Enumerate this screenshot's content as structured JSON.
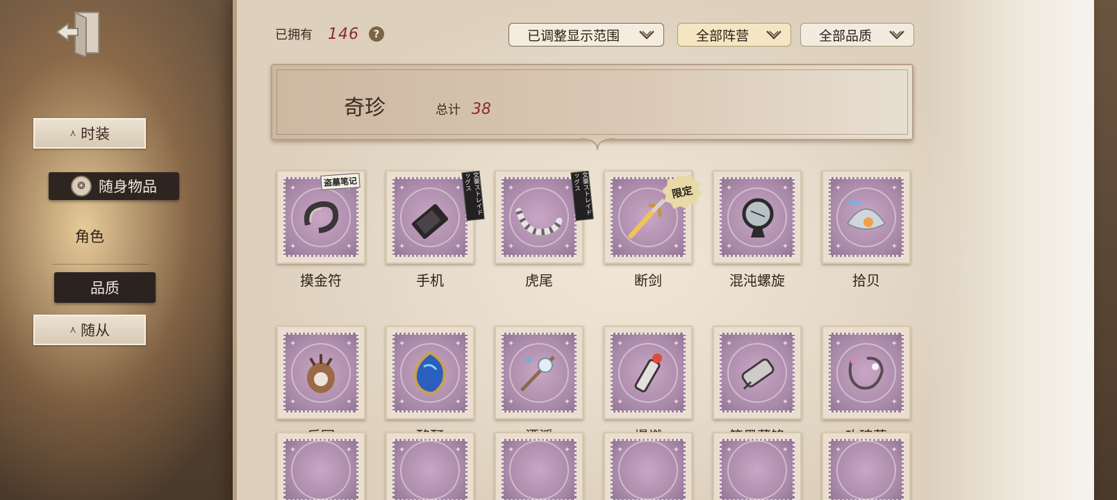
{
  "sidebar": {
    "exit_icon": "exit-door-icon",
    "items": [
      {
        "label": "时装",
        "style": "tab"
      },
      {
        "label": "随身物品",
        "style": "active"
      },
      {
        "label": "角色",
        "style": "plain"
      },
      {
        "label": "品质",
        "style": "dark"
      },
      {
        "label": "随从",
        "style": "tab"
      }
    ]
  },
  "header": {
    "owned_label": "已拥有",
    "owned_count": "146",
    "help_label": "?",
    "filters": [
      {
        "label": "已调整显示范围"
      },
      {
        "label": "全部阵营"
      },
      {
        "label": "全部品质"
      }
    ]
  },
  "banner": {
    "title": "奇珍",
    "total_label": "总计",
    "total_value": "38"
  },
  "items": [
    {
      "name": "摸金符",
      "badge": "盗墓笔记"
    },
    {
      "name": "手机",
      "badge": "文豪ストレイドッグス"
    },
    {
      "name": "虎尾",
      "badge": "文豪ストレイドッグス"
    },
    {
      "name": "断剑",
      "badge": "限定"
    },
    {
      "name": "混沌螺旋",
      "badge": ""
    },
    {
      "name": "拾贝",
      "badge": ""
    },
    {
      "name": "乐园",
      "badge": ""
    },
    {
      "name": "酩酊",
      "badge": ""
    },
    {
      "name": "漂浮",
      "badge": ""
    },
    {
      "name": "爆燃",
      "badge": ""
    },
    {
      "name": "笔墨藏锋",
      "badge": ""
    },
    {
      "name": "玫瑰藤",
      "badge": ""
    }
  ],
  "colors": {
    "accent_number": "#8b2a2a",
    "stamp_purple": "#a98aa8",
    "paper": "#e9dece"
  }
}
